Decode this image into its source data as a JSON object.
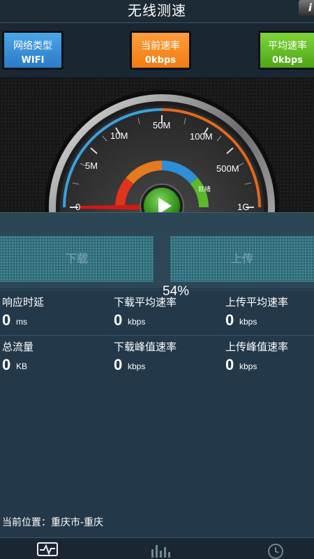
{
  "header": {
    "title": "无线测速",
    "corner_icon_glyph": "i"
  },
  "info_buttons": {
    "network_type": {
      "label": "网络类型",
      "value": "WIFI"
    },
    "current_speed": {
      "label": "当前速率",
      "value": "0kbps"
    },
    "average_speed": {
      "label": "平均速率",
      "value": "0kbps"
    }
  },
  "gauge": {
    "scale_labels": [
      "0",
      "5M",
      "10M",
      "50M",
      "100M",
      "500M",
      "1G"
    ],
    "needle_value": "0",
    "status_badge": "就绪"
  },
  "test": {
    "download_label": "下载",
    "upload_label": "上传",
    "progress": "54%"
  },
  "stats": {
    "latency": {
      "label": "响应时延",
      "value": "0",
      "unit": "ms"
    },
    "download_avg": {
      "label": "下载平均速率",
      "value": "0",
      "unit": "kbps"
    },
    "upload_avg": {
      "label": "上传平均速率",
      "value": "0",
      "unit": "kbps"
    },
    "total_traffic": {
      "label": "总流量",
      "value": "0",
      "unit": "KB"
    },
    "download_peak": {
      "label": "下载峰值速率",
      "value": "0",
      "unit": "kbps"
    },
    "upload_peak": {
      "label": "上传峰值速率",
      "value": "0",
      "unit": "kbps"
    }
  },
  "location": {
    "text": "当前位置：重庆市-重庆"
  },
  "bottom_nav": [
    {
      "icon": "pulse-monitor-icon"
    },
    {
      "icon": "bar-chart-icon"
    },
    {
      "icon": "clock-history-icon"
    }
  ],
  "colors": {
    "accent_blue": "#2b7bc7",
    "accent_orange": "#f07d12",
    "accent_green": "#4ea515",
    "background": "#23394a"
  }
}
